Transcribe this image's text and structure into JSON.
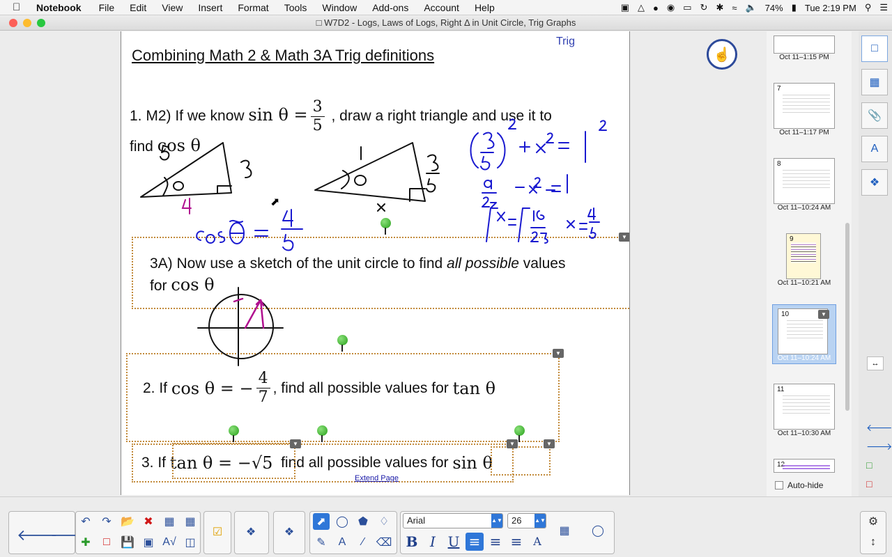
{
  "menubar": {
    "app_name": "Notebook",
    "items": [
      "File",
      "Edit",
      "View",
      "Insert",
      "Format",
      "Tools",
      "Window",
      "Add-ons",
      "Account",
      "Help"
    ],
    "battery": "74%",
    "clock": "Tue 2:19 PM"
  },
  "window": {
    "title": "W7D2 - Logs, Laws of Logs, Right Δ in Unit Circle, Trig Graphs"
  },
  "page": {
    "title": "Combining Math 2 & Math 3A Trig definitions",
    "tag": "Trig",
    "q1": {
      "prefix": "1. M2)  If we know ",
      "math_lhs": "sin θ =",
      "frac_num": "3",
      "frac_den": "5",
      "suffix": " , draw a right triangle and use it to",
      "line2_prefix": "find ",
      "line2_math": "cos θ"
    },
    "q3a": {
      "text_before": "3A) Now use a sketch of the unit circle to find ",
      "text_italic": "all possible",
      "text_after": " values",
      "line2_prefix": "for ",
      "line2_math": "cos θ"
    },
    "q2": {
      "prefix": "2. If ",
      "math_lhs": "cos θ = −",
      "frac_num": "4",
      "frac_den": "7",
      "middle": " , find all possible values for ",
      "math_rhs": "tan θ"
    },
    "q3": {
      "prefix": "3. If ",
      "math_lhs": "tan θ = −√5",
      "middle": " find all possible values for ",
      "math_rhs": "sin θ"
    },
    "extend_page": "Extend Page"
  },
  "page_sorter": {
    "thumbnails": [
      {
        "number": "",
        "label": "Oct 11–1:15 PM"
      },
      {
        "number": "7",
        "label": "Oct 11–1:17 PM"
      },
      {
        "number": "8",
        "label": "Oct 11–10:24 AM"
      },
      {
        "number": "9",
        "label": "Oct 11–10:21 AM"
      },
      {
        "number": "10",
        "label": "Oct 11–10:24 AM"
      },
      {
        "number": "11",
        "label": "Oct 11–10:30 AM"
      },
      {
        "number": "12",
        "label": ""
      }
    ],
    "selected_index": 4,
    "auto_hide_label": "Auto-hide"
  },
  "toolbar": {
    "font_name": "Arial",
    "font_size": "26"
  },
  "colors": {
    "accent": "#2f77d8",
    "ink_black": "#111111",
    "ink_blue": "#1a1ad0",
    "ink_magenta": "#b0108f",
    "dotted_border": "#c28a3a"
  }
}
